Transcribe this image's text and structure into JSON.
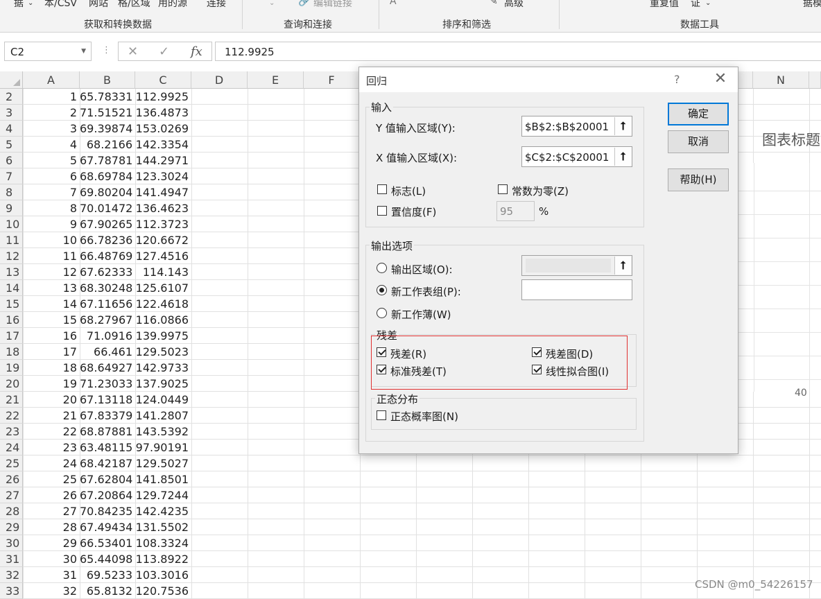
{
  "ribbon": {
    "top_items": [
      "据",
      "本/CSV",
      "网站",
      "格/区域",
      "用的源",
      "连接",
      "编辑链接",
      "高级",
      "重复值",
      "证",
      "据模"
    ],
    "groups": [
      "获取和转换数据",
      "查询和连接",
      "排序和筛选",
      "数据工具"
    ]
  },
  "formula_bar": {
    "name_box": "C2",
    "cancel_icon": "✕",
    "enter_icon": "✓",
    "fx_icon": "fx",
    "formula": "112.9925"
  },
  "columns": [
    "A",
    "B",
    "C",
    "D",
    "E",
    "F",
    "N"
  ],
  "rows": [
    {
      "row": "2",
      "a": "1",
      "b": "65.78331",
      "c": "112.9925"
    },
    {
      "row": "3",
      "a": "2",
      "b": "71.51521",
      "c": "136.4873"
    },
    {
      "row": "4",
      "a": "3",
      "b": "69.39874",
      "c": "153.0269"
    },
    {
      "row": "5",
      "a": "4",
      "b": "68.2166",
      "c": "142.3354"
    },
    {
      "row": "6",
      "a": "5",
      "b": "67.78781",
      "c": "144.2971"
    },
    {
      "row": "7",
      "a": "6",
      "b": "68.69784",
      "c": "123.3024"
    },
    {
      "row": "8",
      "a": "7",
      "b": "69.80204",
      "c": "141.4947"
    },
    {
      "row": "9",
      "a": "8",
      "b": "70.01472",
      "c": "136.4623"
    },
    {
      "row": "10",
      "a": "9",
      "b": "67.90265",
      "c": "112.3723"
    },
    {
      "row": "11",
      "a": "10",
      "b": "66.78236",
      "c": "120.6672"
    },
    {
      "row": "12",
      "a": "11",
      "b": "66.48769",
      "c": "127.4516"
    },
    {
      "row": "13",
      "a": "12",
      "b": "67.62333",
      "c": "114.143"
    },
    {
      "row": "14",
      "a": "13",
      "b": "68.30248",
      "c": "125.6107"
    },
    {
      "row": "15",
      "a": "14",
      "b": "67.11656",
      "c": "122.4618"
    },
    {
      "row": "16",
      "a": "15",
      "b": "68.27967",
      "c": "116.0866"
    },
    {
      "row": "17",
      "a": "16",
      "b": "71.0916",
      "c": "139.9975"
    },
    {
      "row": "18",
      "a": "17",
      "b": "66.461",
      "c": "129.5023"
    },
    {
      "row": "19",
      "a": "18",
      "b": "68.64927",
      "c": "142.9733"
    },
    {
      "row": "20",
      "a": "19",
      "b": "71.23033",
      "c": "137.9025"
    },
    {
      "row": "21",
      "a": "20",
      "b": "67.13118",
      "c": "124.0449"
    },
    {
      "row": "22",
      "a": "21",
      "b": "67.83379",
      "c": "141.2807"
    },
    {
      "row": "23",
      "a": "22",
      "b": "68.87881",
      "c": "143.5392"
    },
    {
      "row": "24",
      "a": "23",
      "b": "63.48115",
      "c": "97.90191"
    },
    {
      "row": "25",
      "a": "24",
      "b": "68.42187",
      "c": "129.5027"
    },
    {
      "row": "26",
      "a": "25",
      "b": "67.62804",
      "c": "141.8501"
    },
    {
      "row": "27",
      "a": "26",
      "b": "67.20864",
      "c": "129.7244"
    },
    {
      "row": "28",
      "a": "27",
      "b": "70.84235",
      "c": "142.4235"
    },
    {
      "row": "29",
      "a": "28",
      "b": "67.49434",
      "c": "131.5502"
    },
    {
      "row": "30",
      "a": "29",
      "b": "66.53401",
      "c": "108.3324"
    },
    {
      "row": "31",
      "a": "30",
      "b": "65.44098",
      "c": "113.8922"
    },
    {
      "row": "32",
      "a": "31",
      "b": "69.5233",
      "c": "103.3016"
    },
    {
      "row": "33",
      "a": "32",
      "b": "65.8132",
      "c": "120.7536"
    }
  ],
  "chart": {
    "title": "图表标题",
    "axis_tick": "40"
  },
  "dialog": {
    "title": "回归",
    "help_icon": "?",
    "close_icon": "✕",
    "input_section": "输入",
    "y_range_label": "Y 值输入区域(Y):",
    "y_range_value": "$B$2:$B$20001",
    "x_range_label": "X 值输入区域(X):",
    "x_range_value": "$C$2:$C$20001",
    "ref_icon": "⭡",
    "labels_label": "标志(L)",
    "labels_checked": false,
    "const_zero_label": "常数为零(Z)",
    "const_zero_checked": false,
    "confidence_label": "置信度(F)",
    "confidence_checked": false,
    "confidence_value": "95",
    "percent": "%",
    "output_section": "输出选项",
    "output_range_label": "输出区域(O):",
    "new_sheet_label": "新工作表组(P):",
    "new_book_label": "新工作薄(W)",
    "selected_output": "new_sheet",
    "residuals_section": "残差",
    "residuals_label": "残差(R)",
    "residual_plots_label": "残差图(D)",
    "std_residuals_label": "标准残差(T)",
    "line_fit_label": "线性拟合图(I)",
    "residuals_checked": true,
    "residual_plots_checked": true,
    "std_residuals_checked": true,
    "line_fit_checked": true,
    "normal_section": "正态分布",
    "normal_prob_label": "正态概率图(N)",
    "normal_prob_checked": false,
    "ok_button": "确定",
    "cancel_button": "取消",
    "help_button": "帮助(H)",
    "accent_color": "#0078d7",
    "highlight_color": "#e03030"
  },
  "watermark": "CSDN @m0_54226157"
}
